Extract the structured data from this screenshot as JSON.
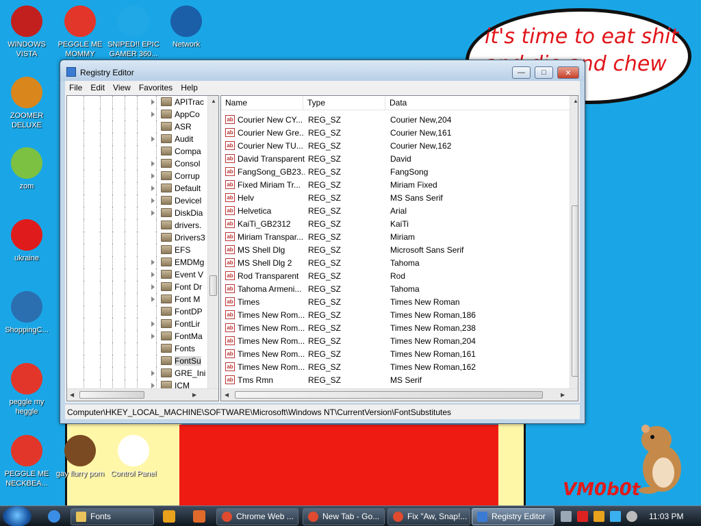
{
  "desktop": {
    "bubble_text": "it's time to eat shit and die and chew gum",
    "signature": "VM0b0t",
    "icons": [
      {
        "label": "WINDOWS VISTA",
        "icon": "vista-bowl-icon",
        "color": "#c2201e"
      },
      {
        "label": "PEGGLE ME MOMMY",
        "icon": "peggle-icon",
        "color": "#e2362a"
      },
      {
        "label": "SNIPED!! EPIC GAMER 360...",
        "icon": "skype-icon",
        "color": "#1fa7e6"
      },
      {
        "label": "Network",
        "icon": "network-globe-icon",
        "color": "#1a5fa8"
      },
      {
        "label": "ZOOMER DELUXE",
        "icon": "zuma-icon",
        "color": "#d9861c"
      },
      {
        "label": "zom",
        "icon": "plant-icon",
        "color": "#7dc142"
      },
      {
        "label": "ukraine",
        "icon": "radiation-icon",
        "color": "#e01b1b"
      },
      {
        "label": "ShoppingC...",
        "icon": "flash-icon",
        "color": "#2b6fb0"
      },
      {
        "label": "peggle my heggle",
        "icon": "peggle-icon",
        "color": "#e2362a"
      },
      {
        "label": "PEGGLE ME NECKBEA...",
        "icon": "peggle-icon",
        "color": "#e2362a"
      },
      {
        "label": "gay flurry porn",
        "icon": "box-beaver-icon",
        "color": "#7a4a22"
      },
      {
        "label": "Control Panel",
        "icon": "control-panel-icon",
        "color": "#ffffff"
      }
    ]
  },
  "window": {
    "title": "Registry Editor",
    "menu": [
      "File",
      "Edit",
      "View",
      "Favorites",
      "Help"
    ],
    "tree_items": [
      "APITrac",
      "AppCo",
      "ASR",
      "Audit",
      "Compa",
      "Consol",
      "Corrup",
      "Default",
      "Devicel",
      "DiskDia",
      "drivers.",
      "Drivers3",
      "EFS",
      "EMDMg",
      "Event V",
      "Font Dr",
      "Font M",
      "FontDP",
      "FontLir",
      "FontMa",
      "Fonts",
      "FontSu",
      "GRE_Ini",
      "ICM"
    ],
    "tree_expandable": [
      true,
      true,
      false,
      true,
      false,
      true,
      true,
      true,
      true,
      true,
      false,
      false,
      false,
      true,
      true,
      true,
      true,
      false,
      true,
      true,
      false,
      false,
      true,
      true
    ],
    "tree_selected_index": 21,
    "columns": [
      "Name",
      "Type",
      "Data"
    ],
    "rows": [
      {
        "name": "Courier New CY...",
        "type": "REG_SZ",
        "data": "Courier New,204"
      },
      {
        "name": "Courier New Gre...",
        "type": "REG_SZ",
        "data": "Courier New,161"
      },
      {
        "name": "Courier New TU...",
        "type": "REG_SZ",
        "data": "Courier New,162"
      },
      {
        "name": "David Transparent",
        "type": "REG_SZ",
        "data": "David"
      },
      {
        "name": "FangSong_GB23...",
        "type": "REG_SZ",
        "data": "FangSong"
      },
      {
        "name": "Fixed Miriam Tr...",
        "type": "REG_SZ",
        "data": "Miriam Fixed"
      },
      {
        "name": "Helv",
        "type": "REG_SZ",
        "data": "MS Sans Serif"
      },
      {
        "name": "Helvetica",
        "type": "REG_SZ",
        "data": "Arial"
      },
      {
        "name": "KaiTi_GB2312",
        "type": "REG_SZ",
        "data": "KaiTi"
      },
      {
        "name": "Miriam Transpar...",
        "type": "REG_SZ",
        "data": "Miriam"
      },
      {
        "name": "MS Shell Dlg",
        "type": "REG_SZ",
        "data": "Microsoft Sans Serif"
      },
      {
        "name": "MS Shell Dlg 2",
        "type": "REG_SZ",
        "data": "Tahoma"
      },
      {
        "name": "Rod Transparent",
        "type": "REG_SZ",
        "data": "Rod"
      },
      {
        "name": "Tahoma Armeni...",
        "type": "REG_SZ",
        "data": "Tahoma"
      },
      {
        "name": "Times",
        "type": "REG_SZ",
        "data": "Times New Roman"
      },
      {
        "name": "Times New Rom...",
        "type": "REG_SZ",
        "data": "Times New Roman,186"
      },
      {
        "name": "Times New Rom...",
        "type": "REG_SZ",
        "data": "Times New Roman,238"
      },
      {
        "name": "Times New Rom...",
        "type": "REG_SZ",
        "data": "Times New Roman,204"
      },
      {
        "name": "Times New Rom...",
        "type": "REG_SZ",
        "data": "Times New Roman,161"
      },
      {
        "name": "Times New Rom...",
        "type": "REG_SZ",
        "data": "Times New Roman,162"
      },
      {
        "name": "Tms Rmn",
        "type": "REG_SZ",
        "data": "MS Serif"
      }
    ],
    "value_icon_text": "ab",
    "status_path": "Computer\\HKEY_LOCAL_MACHINE\\SOFTWARE\\Microsoft\\Windows NT\\CurrentVersion\\FontSubstitutes"
  },
  "taskbar": {
    "buttons": [
      {
        "label": "Fonts",
        "icon": "folder-icon",
        "color": "#e8c25a"
      },
      {
        "label": "Chrome Web ...",
        "icon": "chrome-icon",
        "color": "#e04a2f"
      },
      {
        "label": "New Tab - Go...",
        "icon": "chrome-icon",
        "color": "#e04a2f"
      },
      {
        "label": "Fix \"Aw, Snap!...",
        "icon": "chrome-icon",
        "color": "#e04a2f"
      },
      {
        "label": "Registry Editor",
        "icon": "regedit-icon",
        "color": "#3b7bd4"
      }
    ],
    "quick_launch": [
      "ie-icon",
      "media-player-icon",
      "avast-icon"
    ],
    "tray": [
      "network-tray-icon",
      "antivirus-tray-icon",
      "search-tray-icon",
      "display-tray-icon",
      "volume-tray-icon"
    ],
    "clock": "11:03 PM"
  }
}
